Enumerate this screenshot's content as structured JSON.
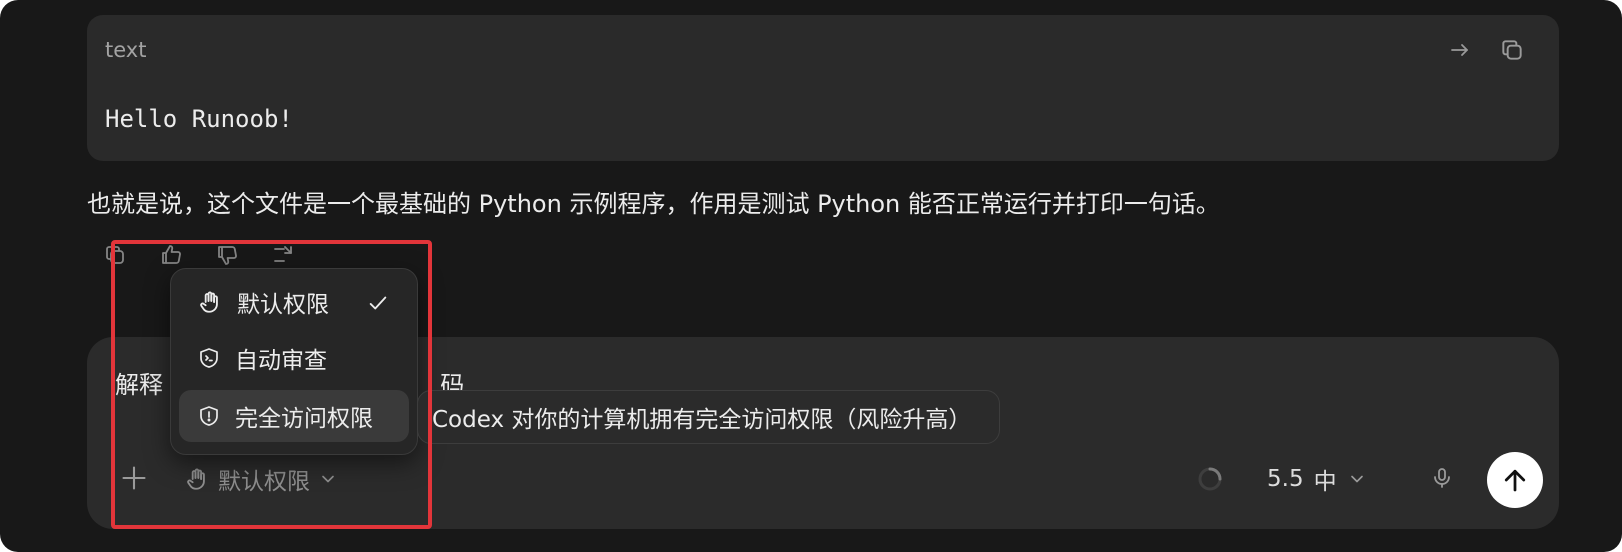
{
  "code_block": {
    "language": "text",
    "content": "Hello Runoob!",
    "actions": [
      "wrap-icon",
      "copy-icon"
    ]
  },
  "message": {
    "text": "也就是说，这个文件是一个最基础的 Python 示例程序，作用是测试 Python 能否正常运行并打印一句话。",
    "actions": [
      "copy-icon",
      "thumbs-up-icon",
      "thumbs-down-icon",
      "branch-icon"
    ]
  },
  "composer": {
    "input_text": "解释",
    "input_text_tail": "码",
    "permission_label": "默认权限",
    "model_version": "5.5",
    "model_effort": "中"
  },
  "permission_menu": {
    "items": [
      {
        "label": "默认权限",
        "icon": "hand-icon",
        "selected": true
      },
      {
        "label": "自动审查",
        "icon": "shield-terminal-icon",
        "selected": false
      },
      {
        "label": "完全访问权限",
        "icon": "shield-alert-icon",
        "selected": false,
        "hovered": true
      }
    ]
  },
  "tooltip": {
    "text": "Codex 对你的计算机拥有完全访问权限（风险升高）"
  },
  "colors": {
    "window_bg": "#181818",
    "panel_bg": "#2a2a2a",
    "highlight": "#e2353a",
    "send_button": "#ffffff"
  }
}
